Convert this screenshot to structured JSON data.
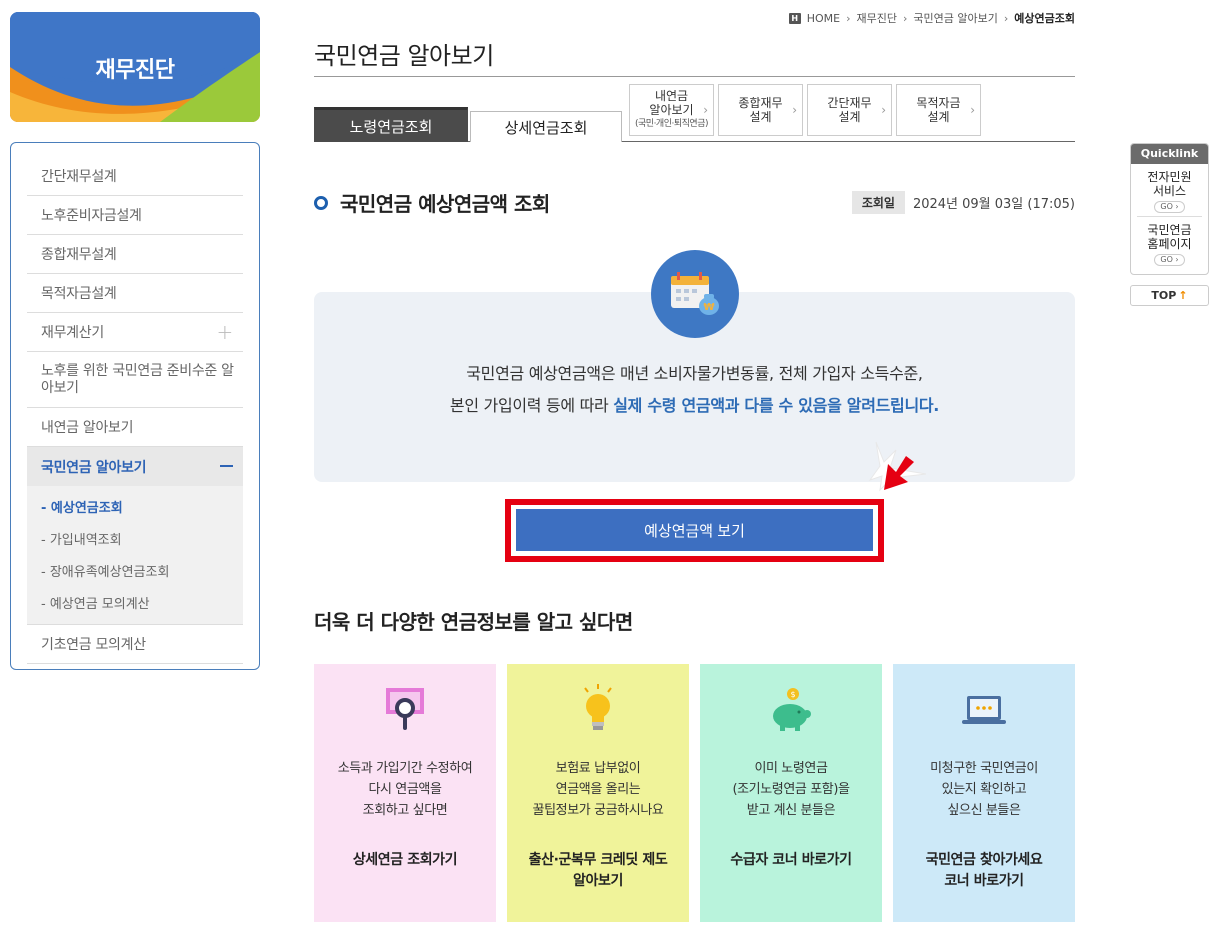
{
  "sidebar": {
    "banner_title": "재무진단",
    "items": [
      {
        "label": "간단재무설계"
      },
      {
        "label": "노후준비자금설계"
      },
      {
        "label": "종합재무설계"
      },
      {
        "label": "목적자금설계"
      },
      {
        "label": "재무계산기",
        "icon": "plus"
      },
      {
        "label": "노후를 위한 국민연금 준비수준 알아보기"
      },
      {
        "label": "내연금 알아보기"
      },
      {
        "label": "국민연금 알아보기",
        "icon": "minus"
      },
      {
        "label": "기초연금 모의계산"
      }
    ],
    "submenu": [
      {
        "label": "- 예상연금조회"
      },
      {
        "label": "- 가입내역조회"
      },
      {
        "label": "- 장애유족예상연금조회"
      },
      {
        "label": "- 예상연금 모의계산"
      }
    ]
  },
  "breadcrumb": {
    "home_icon": "H",
    "home": "HOME",
    "path": [
      "재무진단",
      "국민연금 알아보기"
    ],
    "current": "예상연금조회"
  },
  "page_title": "국민연금 알아보기",
  "tabs": {
    "active": "노령연금조회",
    "inactive": "상세연금조회",
    "links": [
      {
        "line1": "내연금",
        "line2": "알아보기",
        "small": "(국민·개인·퇴직연금)"
      },
      {
        "line1": "종합재무",
        "line2": "설계"
      },
      {
        "line1": "간단재무",
        "line2": "설계"
      },
      {
        "line1": "목적자금",
        "line2": "설계"
      }
    ]
  },
  "section": {
    "title": "국민연금 예상연금액 조회",
    "date_label": "조회일",
    "date_value": "2024년 09월 03일 (17:05)"
  },
  "info": {
    "line1": "국민연금 예상연금액은 매년 소비자물가변동률, 전체 가입자 소득수준,",
    "line2_plain": "본인 가입이력 등에 따라 ",
    "line2_highlight": "실제 수령 연금액과 다를 수 있음을 알려드립니다.",
    "icon_currency": "₩"
  },
  "main_button": "예상연금액 보기",
  "more_title": "더욱 더 다양한 연금정보를 알고 싶다면",
  "cards": [
    {
      "desc": [
        "소득과 가입기간 수정하여",
        "다시 연금액을",
        "조회하고 싶다면"
      ],
      "link": [
        "상세연금 조회가기"
      ],
      "icon": "magnifier-icon"
    },
    {
      "desc": [
        "보험료 납부없이",
        "연금액을 올리는",
        "꿀팁정보가 궁금하시나요"
      ],
      "link": [
        "출산·군복무 크레딧 제도",
        "알아보기"
      ],
      "icon": "lightbulb-icon"
    },
    {
      "desc": [
        "이미 노령연금",
        "(조기노령연금 포함)을",
        "받고 계신 분들은"
      ],
      "link": [
        "수급자 코너 바로가기"
      ],
      "icon": "piggy-bank-icon"
    },
    {
      "desc": [
        "미청구한 국민연금이",
        "있는지 확인하고",
        "싶으신 분들은"
      ],
      "link": [
        "국민연금 찾아가세요",
        "코너 바로가기"
      ],
      "icon": "laptop-icon"
    }
  ],
  "quicklink": {
    "title": "Quicklink",
    "items": [
      {
        "line1": "전자민원",
        "line2": "서비스",
        "go": "GO ›"
      },
      {
        "line1": "국민연금",
        "line2": "홈페이지",
        "go": "GO ›"
      }
    ],
    "top": "TOP",
    "top_arrow": "↑"
  },
  "colors": {
    "primary": "#3d6fc1",
    "highlight_frame": "#e50012",
    "card_pink": "#fbe2f4",
    "card_yellow": "#f0f39a",
    "card_green": "#b9f3dc",
    "card_blue": "#cde9f8"
  }
}
